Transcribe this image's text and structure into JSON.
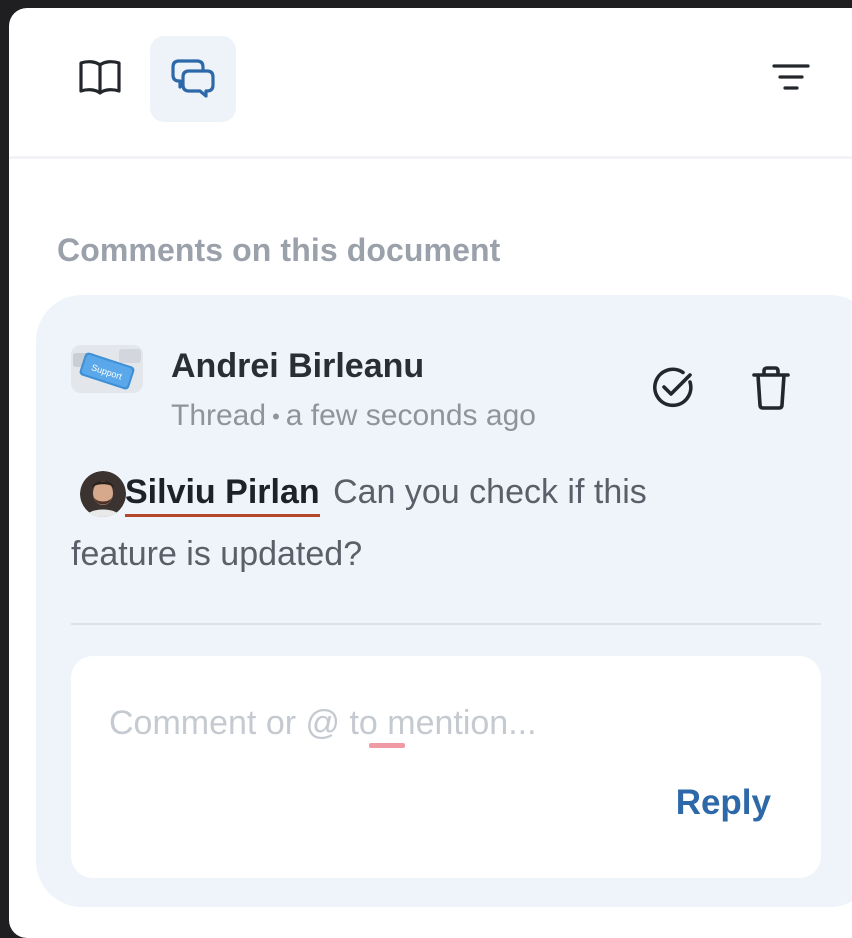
{
  "toolbar": {
    "docs_icon": "book-open-icon",
    "comments_icon": "chat-bubbles-icon",
    "filter_icon": "filter-lines-icon"
  },
  "section": {
    "title": "Comments on this document"
  },
  "comment": {
    "author": "Andrei Birleanu",
    "avatar_label": "Support",
    "thread_label": "Thread",
    "separator": "•",
    "time": "a few seconds ago",
    "resolve_icon": "check-circle-icon",
    "delete_icon": "trash-icon",
    "mention_name": "Silviu Pirlan",
    "text": "Can you check if this feature is updated?"
  },
  "reply": {
    "placeholder": "Comment or @ to mention...",
    "value": "",
    "button_label": "Reply"
  },
  "colors": {
    "accent": "#2d68a8",
    "card_background": "#eff4fa",
    "mention_underline": "#b5472a"
  }
}
